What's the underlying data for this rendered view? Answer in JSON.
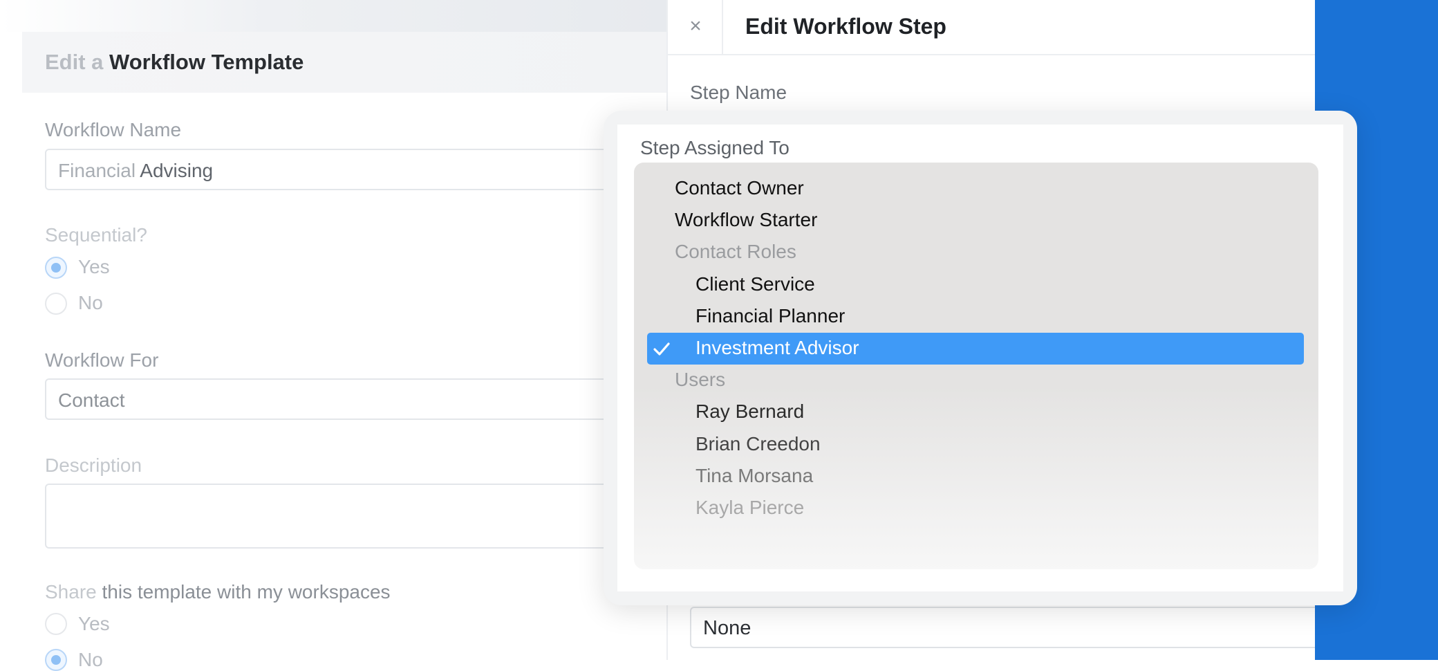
{
  "background_form": {
    "title_prefix": "Edit a",
    "title_main": "Workflow Template",
    "workflow_name_label": "Workflow Name",
    "workflow_name_value_prefix": "Financial",
    "workflow_name_value_rest": " Advising",
    "sequential_label": "Sequential?",
    "sequential_yes": "Yes",
    "sequential_no": "No",
    "workflow_for_label": "Workflow For",
    "workflow_for_value": "Contact",
    "description_label": "Description",
    "share_label_prefix": "Share",
    "share_label_rest": " this template with my workspaces",
    "share_yes": "Yes",
    "share_no": "No"
  },
  "panel": {
    "close_icon": "×",
    "title": "Edit Workflow Step",
    "step_name_label": "Step Name",
    "bottom_select_value": "None"
  },
  "dropdown": {
    "label": "Step Assigned To",
    "selected_icon": "check-icon",
    "options": [
      {
        "label": "Contact Owner",
        "type": "option",
        "level": 0,
        "color": "#111111"
      },
      {
        "label": "Workflow Starter",
        "type": "option",
        "level": 0,
        "color": "#111111"
      },
      {
        "label": "Contact Roles",
        "type": "group",
        "level": 0
      },
      {
        "label": "Client Service",
        "type": "option",
        "level": 1,
        "color": "#111111"
      },
      {
        "label": "Financial Planner",
        "type": "option",
        "level": 1,
        "color": "#111111"
      },
      {
        "label": "Investment Advisor",
        "type": "option",
        "level": 1,
        "selected": true
      },
      {
        "label": "Users",
        "type": "group",
        "level": 0
      },
      {
        "label": "Ray Bernard",
        "type": "option",
        "level": 1,
        "color": "#2b2b2b"
      },
      {
        "label": "Brian Creedon",
        "type": "option",
        "level": 1,
        "color": "#444444"
      },
      {
        "label": "Tina Morsana",
        "type": "option",
        "level": 1,
        "color": "#7a7a7a"
      },
      {
        "label": "Kayla Pierce",
        "type": "option",
        "level": 1,
        "color": "#a8a8a8"
      }
    ]
  },
  "colors": {
    "accent_blue": "#1a72d6",
    "selected_option_bg": "#3f9af7"
  }
}
